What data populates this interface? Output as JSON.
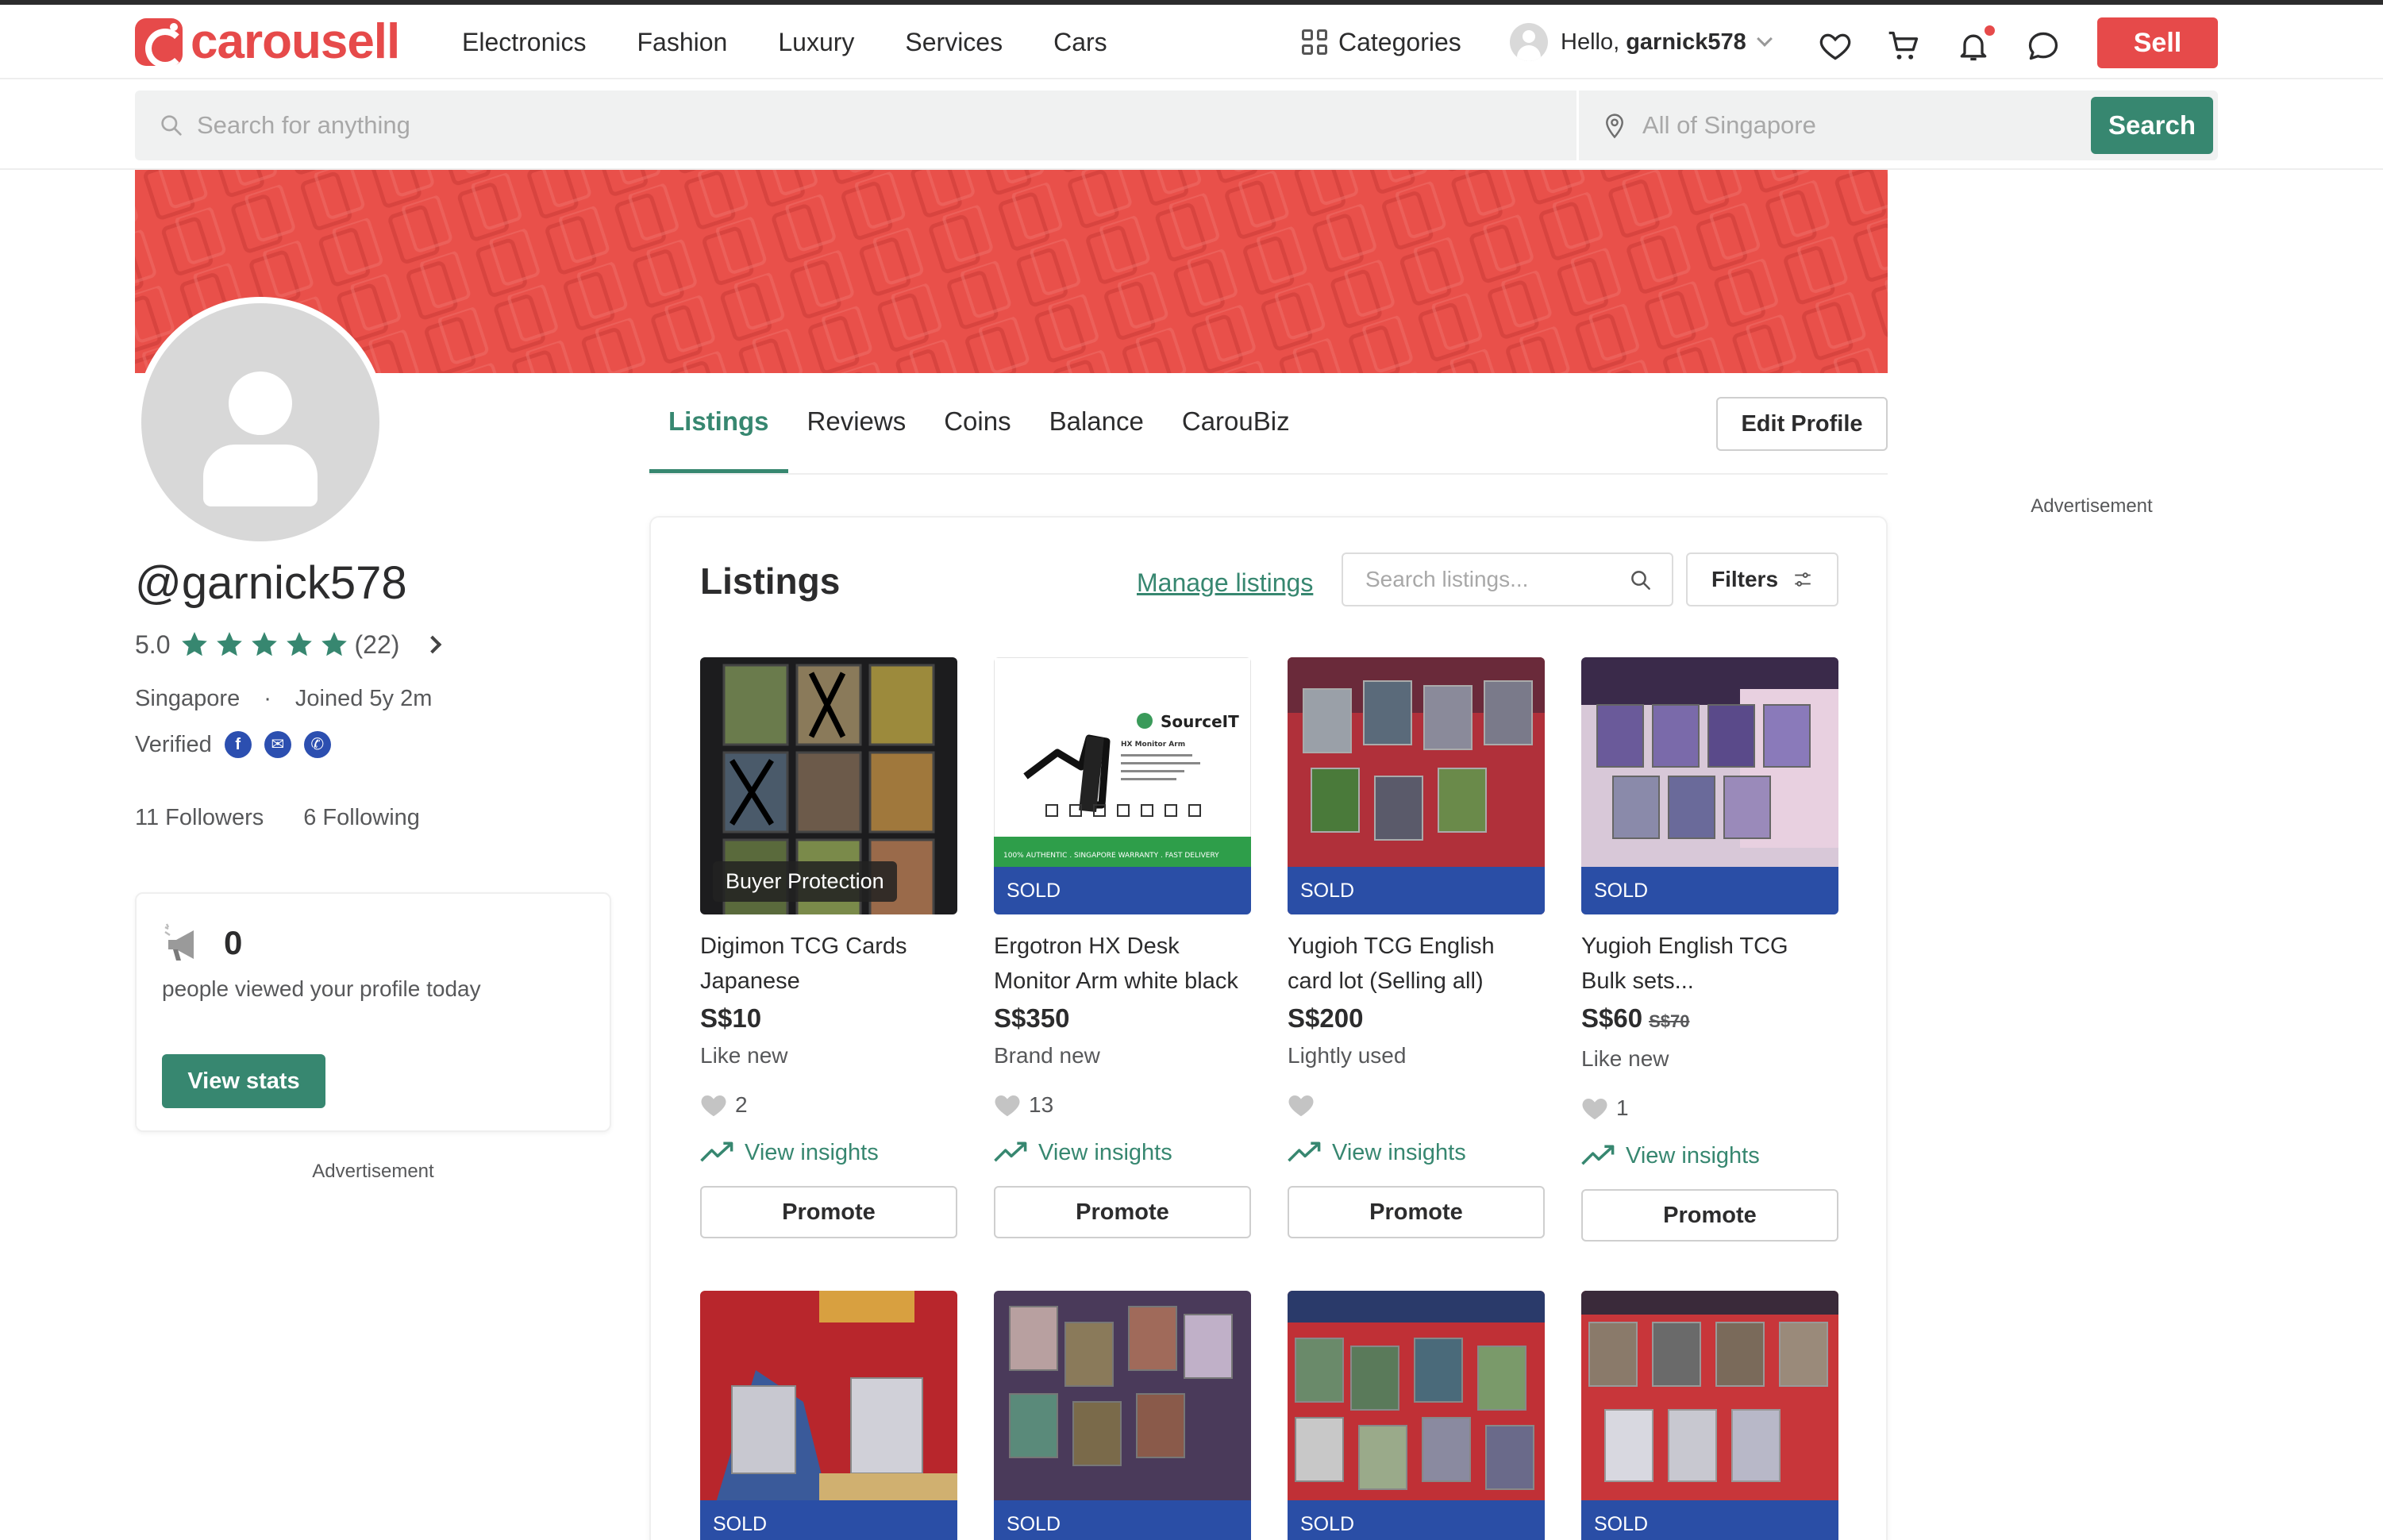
{
  "header": {
    "logo_text": "carousell",
    "nav": [
      "Electronics",
      "Fashion",
      "Luxury",
      "Services",
      "Cars"
    ],
    "categories_label": "Categories",
    "hello_prefix": "Hello, ",
    "username": "garnick578",
    "sell_label": "Sell",
    "brand_color": "#e64a4a"
  },
  "search": {
    "placeholder": "Search for anything",
    "location_placeholder": "All of Singapore",
    "button_label": "Search",
    "accent_color": "#378770"
  },
  "profile": {
    "handle": "@garnick578",
    "rating": "5.0",
    "stars": 5,
    "review_count": "(22)",
    "location": "Singapore",
    "joined": "Joined 5y 2m",
    "verified_label": "Verified",
    "verified_icons": [
      "facebook-icon",
      "email-icon",
      "phone-icon"
    ],
    "followers": "11 Followers",
    "following": "6 Following"
  },
  "stats": {
    "count": "0",
    "text": "people viewed your profile today",
    "button": "View stats"
  },
  "ads": {
    "left": "Advertisement",
    "right": "Advertisement"
  },
  "tabs": [
    {
      "label": "Listings",
      "active": true
    },
    {
      "label": "Reviews",
      "active": false
    },
    {
      "label": "Coins",
      "active": false
    },
    {
      "label": "Balance",
      "active": false
    },
    {
      "label": "CarouBiz",
      "active": false
    }
  ],
  "edit_profile": "Edit Profile",
  "listings": {
    "title": "Listings",
    "manage": "Manage listings",
    "search_placeholder": "Search listings...",
    "filters": "Filters",
    "insights_label": "View insights",
    "promote_label": "Promote",
    "items": [
      {
        "title": "Digimon TCG Cards Japanese",
        "price": "S$10",
        "original_price": "",
        "condition": "Like new",
        "likes": "2",
        "badge": "Buyer Protection",
        "status": ""
      },
      {
        "title": "Ergotron HX Desk Monitor Arm white black",
        "price": "S$350",
        "original_price": "",
        "condition": "Brand new",
        "likes": "13",
        "badge": "",
        "status": "SOLD",
        "image_text": {
          "brand": "SourceIT",
          "product": "HX Monitor Arm",
          "footer": "100% AUTHENTIC . SINGAPORE WARRANTY . FAST DELIVERY"
        }
      },
      {
        "title": "Yugioh TCG English card lot (Selling all)",
        "price": "S$200",
        "original_price": "",
        "condition": "Lightly used",
        "likes": "",
        "badge": "",
        "status": "SOLD"
      },
      {
        "title": "Yugioh English TCG Bulk sets...",
        "price": "S$60",
        "original_price": "S$70",
        "condition": "Like new",
        "likes": "1",
        "badge": "",
        "status": "SOLD"
      },
      {
        "title": "",
        "price": "",
        "original_price": "",
        "condition": "",
        "likes": "",
        "badge": "",
        "status": "SOLD"
      },
      {
        "title": "",
        "price": "",
        "original_price": "",
        "condition": "",
        "likes": "",
        "badge": "",
        "status": "SOLD"
      },
      {
        "title": "",
        "price": "",
        "original_price": "",
        "condition": "",
        "likes": "",
        "badge": "",
        "status": "SOLD"
      },
      {
        "title": "",
        "price": "",
        "original_price": "",
        "condition": "",
        "likes": "",
        "badge": "",
        "status": "SOLD"
      }
    ]
  }
}
